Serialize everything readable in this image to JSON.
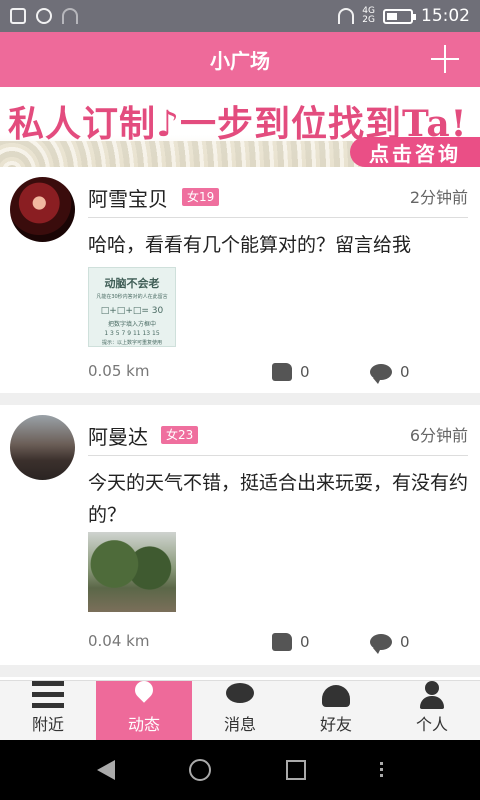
{
  "status": {
    "time": "15:02",
    "network": "4G\n2G"
  },
  "header": {
    "title": "小广场"
  },
  "banner": {
    "headline": "私人订制♪一步到位找到Ta!",
    "cta": "点击咨询"
  },
  "posts": [
    {
      "name": "阿雪宝贝",
      "tag": "女19",
      "time": "2分钟前",
      "text": "哈哈，看看有几个能算对的？留言给我",
      "distance": "0.05 km",
      "likes": "0",
      "comments": "0",
      "thumb": {
        "title": "动脑不会老",
        "line1": "凡能在30秒内答对的人在此留言",
        "eq": "□+□+□= 30",
        "line2": "把数字填入方框中",
        "nums": "1 3 5 7 9 11 13 15",
        "note": "提示：以上数字可重复使用"
      }
    },
    {
      "name": "阿曼达",
      "tag": "女23",
      "time": "6分钟前",
      "text": "今天的天气不错，挺适合出来玩耍，有没有约的？",
      "distance": "0.04 km",
      "likes": "0",
      "comments": "0"
    }
  ],
  "tabs": [
    {
      "label": "附近",
      "icon": "menu-icon"
    },
    {
      "label": "动态",
      "icon": "location-pin-icon"
    },
    {
      "label": "消息",
      "icon": "chat-icon"
    },
    {
      "label": "好友",
      "icon": "friends-icon"
    },
    {
      "label": "个人",
      "icon": "user-icon"
    }
  ],
  "colors": {
    "accent": "#ee6a9a",
    "statusbar": "#6f6f78"
  }
}
